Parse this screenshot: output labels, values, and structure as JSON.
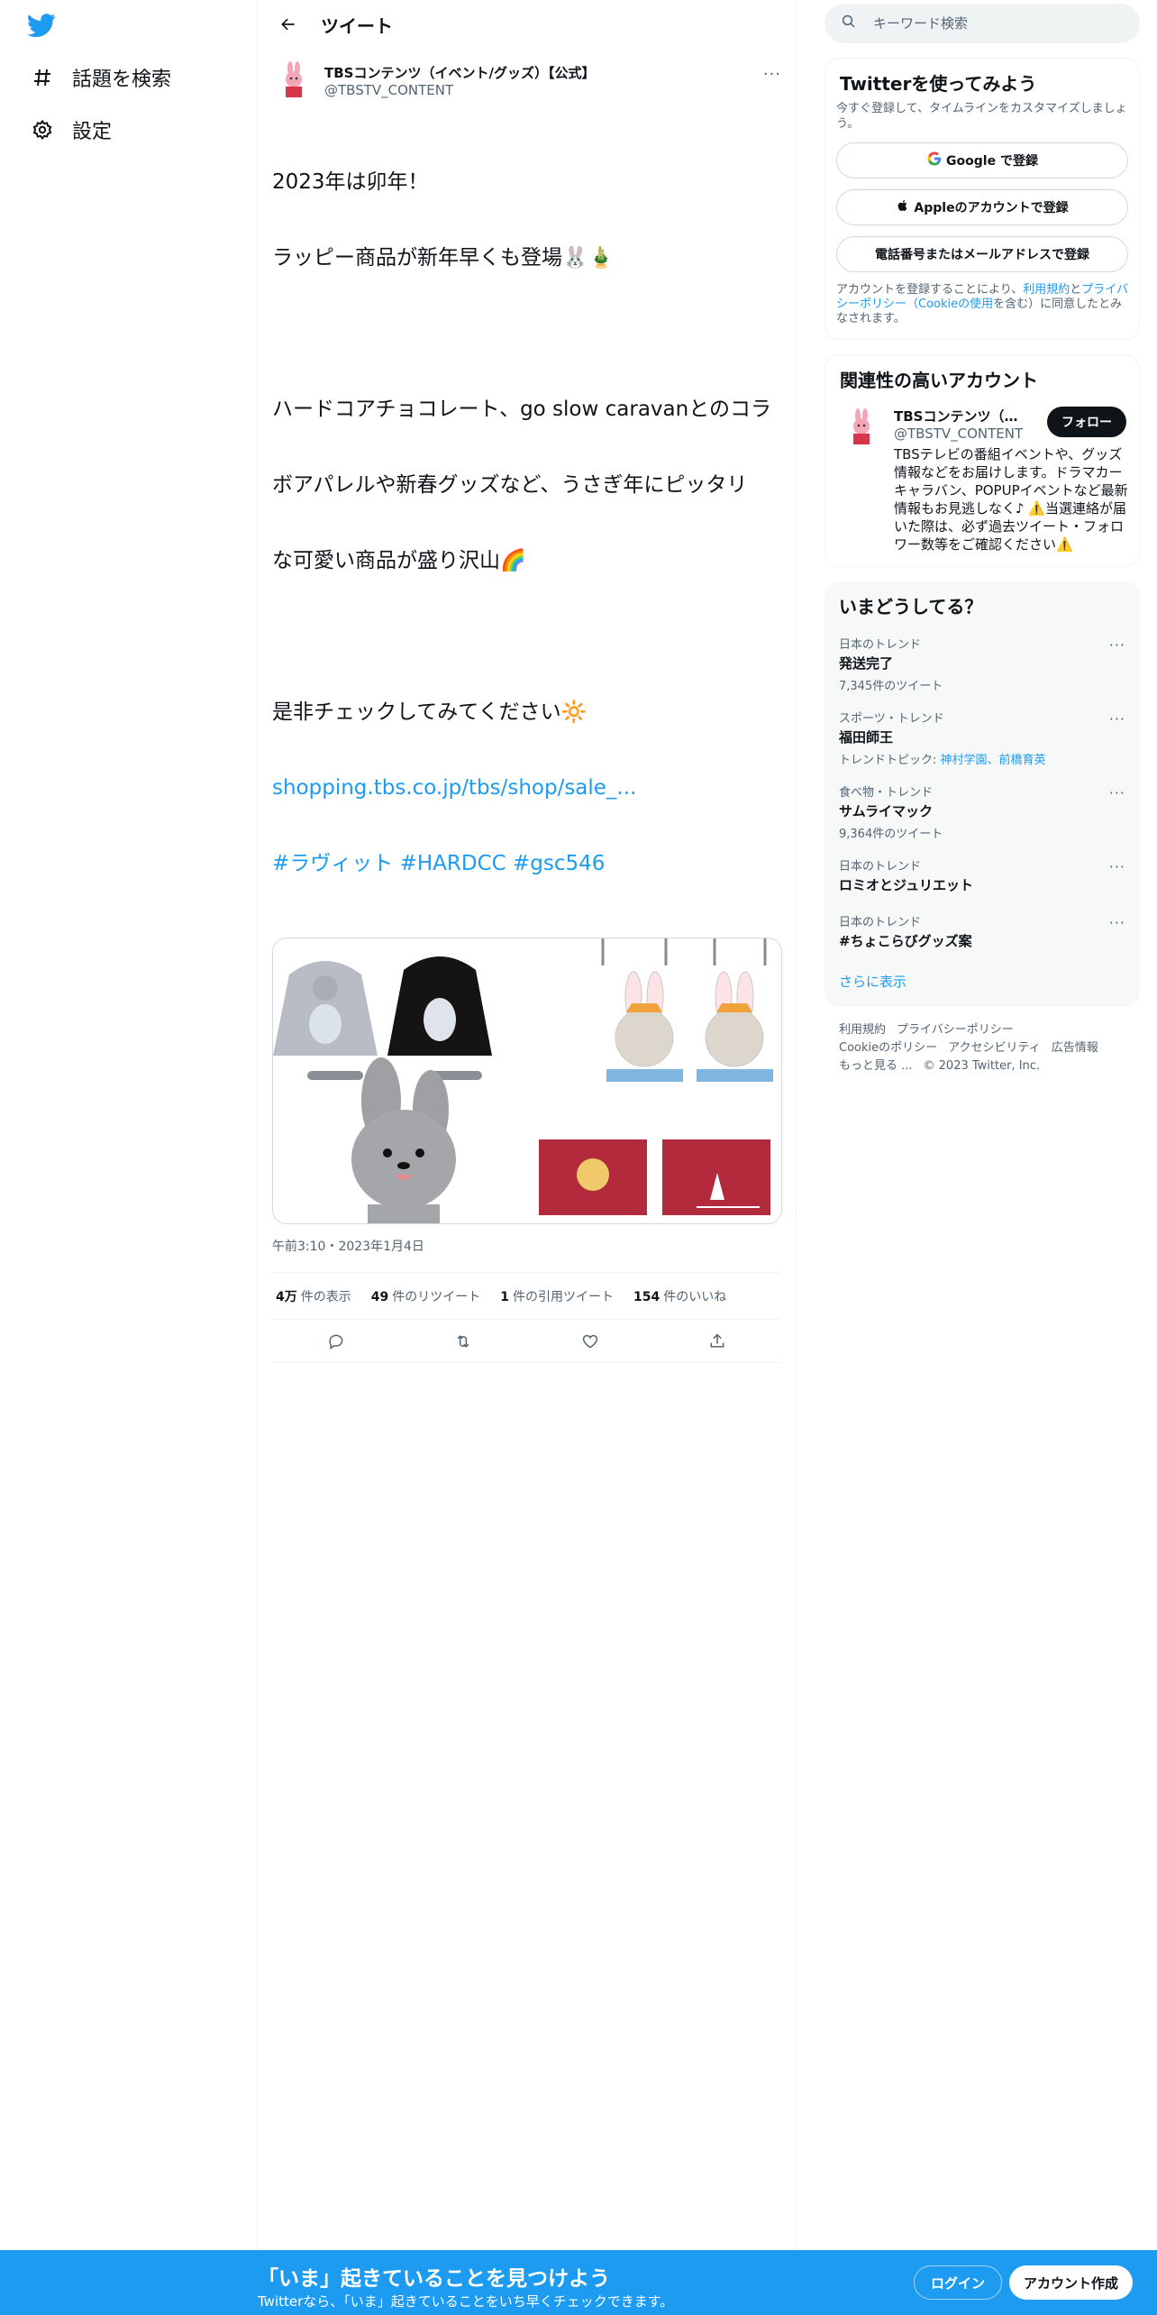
{
  "nav": {
    "explore_label": "話題を検索",
    "settings_label": "設定"
  },
  "header": {
    "title": "ツイート"
  },
  "tweet": {
    "author_name": "TBSコンテンツ（イベント/グッズ）【公式】",
    "author_handle": "@TBSTV_CONTENT",
    "more_label": "···",
    "lines": [
      "2023年は卯年！",
      "ラッピー商品が新年早くも登場🐰🎍",
      "",
      "ハードコアチョコレート、go slow caravanとのコラ",
      "ボアパレルや新春グッズなど、うさぎ年にピッタリ",
      "な可愛い商品が盛り沢山🌈",
      "",
      "是非チェックしてみてください🔆"
    ],
    "link": "shopping.tbs.co.jp/tbs/shop/sale_...",
    "hashtags": "#ラヴィット #HARDCC #gsc546",
    "timestamp": "午前3:10・2023年1月4日",
    "stats": {
      "views_count": "4万",
      "views_label": "件の表示",
      "retweets_count": "49",
      "retweets_label": "件のリツイート",
      "quotes_count": "1",
      "quotes_label": "件の引用ツイート",
      "likes_count": "154",
      "likes_label": "件のいいね"
    }
  },
  "right": {
    "search_placeholder": "キーワード検索",
    "signup": {
      "title": "Twitterを使ってみよう",
      "desc": "今すぐ登録して、タイムラインをカスタマイズしましょう。",
      "google": "Google で登録",
      "apple": "Appleのアカウントで登録",
      "phone": "電話番号またはメールアドレスで登録",
      "terms_pre": "アカウントを登録することにより、",
      "terms_link1": "利用規約",
      "terms_mid": "と",
      "terms_link2": "プライバシーポリシー（Cookieの使用",
      "terms_post": "を含む）に同意したとみなされます。"
    },
    "related": {
      "title": "関連性の高いアカウント",
      "name": "TBSコンテンツ（イベント/グッズ）【公式】",
      "handle": "@TBSTV_CONTENT",
      "follow": "フォロー",
      "bio": "TBSテレビの番組イベントや、グッズ情報などをお届けします。ドラマカーキャラバン、POPUPイベントなど最新情報もお見逃しなく♪ ⚠️当選連絡が届いた際は、必ず過去ツイート・フォロワー数等をご確認ください⚠️"
    },
    "trends": {
      "title": "いまどうしてる？",
      "items": [
        {
          "category": "日本のトレンド",
          "name": "発送完了",
          "count": "7,345件のツイート"
        },
        {
          "category": "スポーツ・トレンド",
          "name": "福田師王",
          "topic_pre": "トレンドトピック: ",
          "topic": "神村学園、前橋育英"
        },
        {
          "category": "食べ物・トレンド",
          "name": "サムライマック",
          "count": "9,364件のツイート"
        },
        {
          "category": "日本のトレンド",
          "name": "ロミオとジュリエット"
        },
        {
          "category": "日本のトレンド",
          "name": "#ちょこらびグッズ案"
        }
      ],
      "show_more": "さらに表示"
    },
    "footer": {
      "terms": "利用規約",
      "privacy": "プライバシーポリシー",
      "cookie": "Cookieのポリシー",
      "access": "アクセシビリティ",
      "ads": "広告情報",
      "more": "もっと見る ...",
      "copyright": "© 2023 Twitter, Inc."
    }
  },
  "bottombar": {
    "title": "「いま」起きていることを見つけよう",
    "subtitle": "Twitterなら、「いま」起きていることをいち早くチェックできます。",
    "login": "ログイン",
    "signup": "アカウント作成"
  },
  "colors": {
    "brand": "#1d9bf0",
    "text": "#0f1419",
    "secondary": "#536471"
  }
}
